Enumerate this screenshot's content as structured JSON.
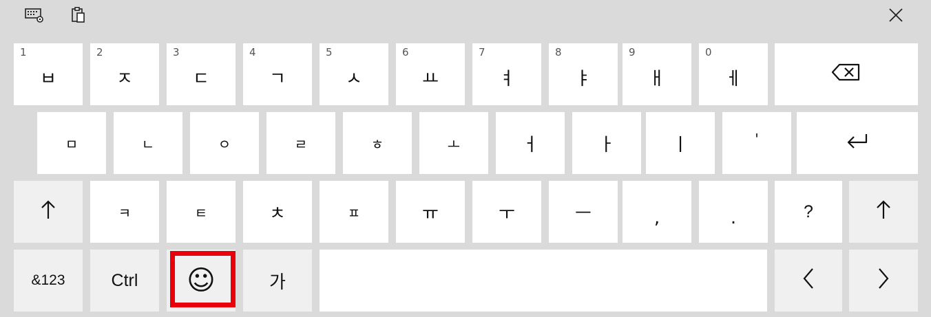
{
  "toolbar": {
    "settings_icon": "keyboard-settings-icon",
    "clipboard_icon": "clipboard-icon",
    "close_icon": "close-icon"
  },
  "rows": {
    "row1": [
      {
        "num": "1",
        "label": "ㅂ"
      },
      {
        "num": "2",
        "label": "ㅈ"
      },
      {
        "num": "3",
        "label": "ㄷ"
      },
      {
        "num": "4",
        "label": "ㄱ"
      },
      {
        "num": "5",
        "label": "ㅅ"
      },
      {
        "num": "6",
        "label": "ㅛ"
      },
      {
        "num": "7",
        "label": "ㅕ"
      },
      {
        "num": "8",
        "label": "ㅑ"
      },
      {
        "num": "9",
        "label": "ㅐ"
      },
      {
        "num": "0",
        "label": "ㅔ"
      }
    ],
    "row2": [
      "ㅁ",
      "ㄴ",
      "ㅇ",
      "ㄹ",
      "ㅎ",
      "ㅗ",
      "ㅓ",
      "ㅏ",
      "ㅣ",
      "'"
    ],
    "row3": [
      "ㅋ",
      "ㅌ",
      "ㅊ",
      "ㅍ",
      "ㅠ",
      "ㅜ",
      "ㅡ",
      ",",
      ".",
      "?"
    ],
    "row4": {
      "symbols": "&123",
      "ctrl": "Ctrl",
      "emoji": "☺",
      "lang": "가"
    }
  },
  "keys": {
    "backspace_icon": "backspace-icon",
    "enter_icon": "enter-icon",
    "shift_icon": "shift-arrow-icon",
    "left_icon": "left-arrow-icon",
    "right_icon": "right-arrow-icon"
  },
  "colors": {
    "background": "#dadada",
    "key": "#ffffff",
    "key_alt": "#f0f0f0",
    "highlight": "#e8000b"
  }
}
